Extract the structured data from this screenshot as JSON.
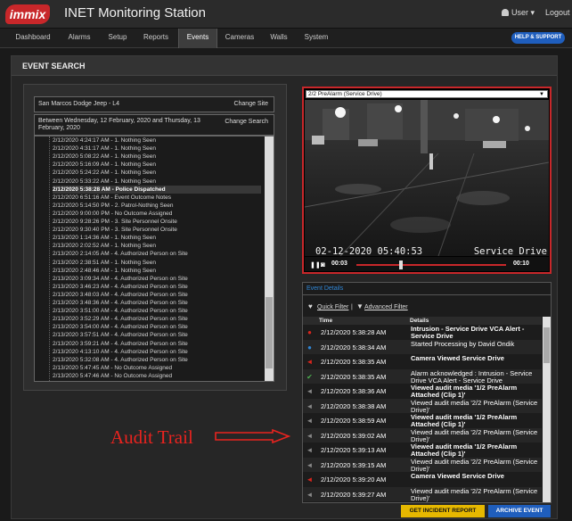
{
  "header": {
    "logo_text": "immix",
    "title": "INET Monitoring Station",
    "user_label": "User",
    "user_caret": "▾",
    "logout_label": "Logout"
  },
  "nav": {
    "items": [
      "Dashboard",
      "Alarms",
      "Setup",
      "Reports",
      "Events",
      "Cameras",
      "Walls",
      "System"
    ],
    "active": "Events",
    "help_label": "HELP & SUPPORT"
  },
  "page": {
    "title": "EVENT SEARCH"
  },
  "search": {
    "site": "San Marcos Dodge Jeep - L4",
    "change_site_label": "Change Site",
    "date_range": "Between Wednesday, 12 February, 2020 and Thursday, 13 February, 2020",
    "change_search_label": "Change Search"
  },
  "events": [
    "2/12/2020 4:24:17 AM - 1. Nothing Seen",
    "2/12/2020 4:31:17 AM - 1. Nothing Seen",
    "2/12/2020 5:08:22 AM - 1. Nothing Seen",
    "2/12/2020 5:16:09 AM - 1. Nothing Seen",
    "2/12/2020 5:24:22 AM - 1. Nothing Seen",
    "2/12/2020 5:33:22 AM - 1. Nothing Seen",
    "2/12/2020 5:38:28 AM - Police Dispatched",
    "2/12/2020 6:51:16 AM - Event Outcome Notes",
    "2/12/2020 5:14:50 PM - 2. Patrol-Nothing Seen",
    "2/12/2020 9:00:00 PM - No Outcome Assigned",
    "2/12/2020 9:28:26 PM - 3. Site Personnel Onsite",
    "2/12/2020 9:30:40 PM - 3. Site Personnel Onsite",
    "2/13/2020 1:14:36 AM - 1. Nothing Seen",
    "2/13/2020 2:02:52 AM - 1. Nothing Seen",
    "2/13/2020 2:14:05 AM - 4. Authorized Person on Site",
    "2/13/2020 2:38:51 AM - 1. Nothing Seen",
    "2/13/2020 2:48:46 AM - 1. Nothing Seen",
    "2/13/2020 3:09:34 AM - 4. Authorized Person on Site",
    "2/13/2020 3:46:23 AM - 4. Authorized Person on Site",
    "2/13/2020 3:48:03 AM - 4. Authorized Person on Site",
    "2/13/2020 3:48:36 AM - 4. Authorized Person on Site",
    "2/13/2020 3:51:00 AM - 4. Authorized Person on Site",
    "2/13/2020 3:52:29 AM - 4. Authorized Person on Site",
    "2/13/2020 3:54:00 AM - 4. Authorized Person on Site",
    "2/13/2020 3:57:51 AM - 4. Authorized Person on Site",
    "2/13/2020 3:59:21 AM - 4. Authorized Person on Site",
    "2/13/2020 4:13:10 AM - 4. Authorized Person on Site",
    "2/13/2020 5:32:08 AM - 4. Authorized Person on Site",
    "2/13/2020 5:47:45 AM - No Outcome Assigned",
    "2/13/2020 5:47:46 AM - No Outcome Assigned"
  ],
  "selected_event_index": 6,
  "video": {
    "camera_select": "2/2 PreAlarm (Service Drive)",
    "overlay_timestamp": "02-12-2020 05:40:53",
    "overlay_camera": "Service Drive",
    "current_time": "00:03",
    "end_time": "00:10",
    "progress": 0.3
  },
  "details": {
    "title": "Event Details",
    "quick_filter": "Quick Filter",
    "separator": "|",
    "advanced_filter": "Advanced Filter",
    "col_time": "Time",
    "col_details": "Details",
    "rows": [
      {
        "icon": "alarm-icon",
        "color": "#d9251d",
        "glyph": "●",
        "time": "2/12/2020 5:38:28 AM",
        "text": "Intrusion - Service Drive VCA Alert - Service Drive",
        "bold": true
      },
      {
        "icon": "user-icon",
        "color": "#2f86d6",
        "glyph": "●",
        "time": "2/12/2020 5:38:34 AM",
        "text": "Started Processing by David Ondik",
        "bold": false
      },
      {
        "icon": "camera-icon",
        "color": "#d9251d",
        "glyph": "◄",
        "time": "2/12/2020 5:38:35 AM",
        "text": "Camera Viewed Service Drive",
        "bold": true
      },
      {
        "icon": "check-icon",
        "color": "#4caf50",
        "glyph": "✔",
        "time": "2/12/2020 5:38:35 AM",
        "text": "Alarm acknowledged : Intrusion - Service Drive VCA Alert - Service Drive",
        "bold": false
      },
      {
        "icon": "camera-icon",
        "color": "#888888",
        "glyph": "◄",
        "time": "2/12/2020 5:38:36 AM",
        "text": "Viewed audit media '1/2 PreAlarm Attached (Clip 1)'",
        "bold": true
      },
      {
        "icon": "camera-icon",
        "color": "#888888",
        "glyph": "◄",
        "time": "2/12/2020 5:38:38 AM",
        "text": "Viewed audit media '2/2 PreAlarm (Service Drive)'",
        "bold": false
      },
      {
        "icon": "camera-icon",
        "color": "#888888",
        "glyph": "◄",
        "time": "2/12/2020 5:38:59 AM",
        "text": "Viewed audit media '1/2 PreAlarm Attached (Clip 1)'",
        "bold": true
      },
      {
        "icon": "camera-icon",
        "color": "#888888",
        "glyph": "◄",
        "time": "2/12/2020 5:39:02 AM",
        "text": "Viewed audit media '2/2 PreAlarm (Service Drive)'",
        "bold": false
      },
      {
        "icon": "camera-icon",
        "color": "#888888",
        "glyph": "◄",
        "time": "2/12/2020 5:39:13 AM",
        "text": "Viewed audit media '1/2 PreAlarm Attached (Clip 1)'",
        "bold": true
      },
      {
        "icon": "camera-icon",
        "color": "#888888",
        "glyph": "◄",
        "time": "2/12/2020 5:39:15 AM",
        "text": "Viewed audit media '2/2 PreAlarm (Service Drive)'",
        "bold": false
      },
      {
        "icon": "camera-icon",
        "color": "#d9251d",
        "glyph": "◄",
        "time": "2/12/2020 5:39:20 AM",
        "text": "Camera Viewed Service Drive",
        "bold": true
      },
      {
        "icon": "camera-icon",
        "color": "#888888",
        "glyph": "◄",
        "time": "2/12/2020 5:39:27 AM",
        "text": "Viewed audit media '2/2 PreAlarm (Service Drive)'",
        "bold": false
      }
    ]
  },
  "annotation": {
    "text": "Audit Trail",
    "color": "#e8231f"
  },
  "buttons": {
    "incident_report": "GET INCIDENT REPORT",
    "archive_event": "ARCHIVE EVENT"
  }
}
